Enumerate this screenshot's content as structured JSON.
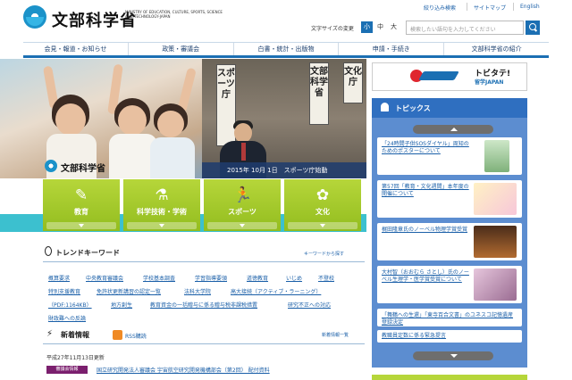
{
  "header": {
    "logo_text": "文部科学省",
    "logo_en": "MINISTRY OF EDUCATION, CULTURE, SPORTS, SCIENCE AND TECHNOLOGY-JAPAN",
    "utility_links": [
      "絞り込み検索",
      "サイトマップ",
      "English"
    ],
    "font_size_label": "文字サイズの変更",
    "font_sizes": [
      "小",
      "中",
      "大"
    ],
    "search_placeholder": "検索したい語句を入力してください"
  },
  "nav": {
    "items": [
      "会見・報道・お知らせ",
      "政策・審議会",
      "白書・統計・出版物",
      "申請・手続き",
      "文部科学省の紹介"
    ]
  },
  "hero": {
    "caption": "2015年 10月 1日　スポーツ庁始動",
    "sign_left": "スポーツ庁",
    "sign_mid": "文部科学省",
    "sign_right": "文化庁",
    "logo_text": "文部科学省"
  },
  "categories": [
    {
      "label": "教育",
      "icon": "pencil-icon"
    },
    {
      "label": "科学技術・学術",
      "icon": "flask-icon"
    },
    {
      "label": "スポーツ",
      "icon": "runner-icon"
    },
    {
      "label": "文化",
      "icon": "ribbon-icon"
    }
  ],
  "trend": {
    "title": "トレンドキーワード",
    "link": "キーワードから探す",
    "keywords": [
      "概算要求",
      "中央教育審議会",
      "学校基本調査",
      "学習指導要領",
      "道徳教育",
      "いじめ",
      "不登校",
      "特別支援教育",
      "免許状更新講習の認定一覧",
      "法科大学院",
      "高大接続（アクティブ・ラーニング）",
      "（PDF:1164KB）",
      "地方創生",
      "教育資金の一括贈与に係る贈与税非課税措置",
      "研究不正への対応",
      "財政難への反論"
    ]
  },
  "news": {
    "title": "新着情報",
    "rss_label": "RSS購読",
    "more": "新着情報一覧",
    "date": "平成27年11月13日更新",
    "badge": "審議会情報",
    "link": "国立研究開発法人審議会 宇宙航空研究開発機構部会（第2回） 配付資料"
  },
  "banner": {
    "title": "トビタテ!",
    "subtitle": "留学JAPAN"
  },
  "topics": {
    "title": "トピックス",
    "items": [
      "「24時間子供SOSダイヤル」周知のためのポスターについて",
      "第57回「教育・文化週間」本年度の開催について",
      "梶田隆章氏のノーベル物理学賞受賞",
      "大村智（おおむら さとし）氏のノーベル生理学・医学賞受賞について",
      "「舞鶴への生還」「東寺百合文書」のユネスコ記憶遺産登録決定",
      "教職員定数に係る緊急提言"
    ]
  }
}
